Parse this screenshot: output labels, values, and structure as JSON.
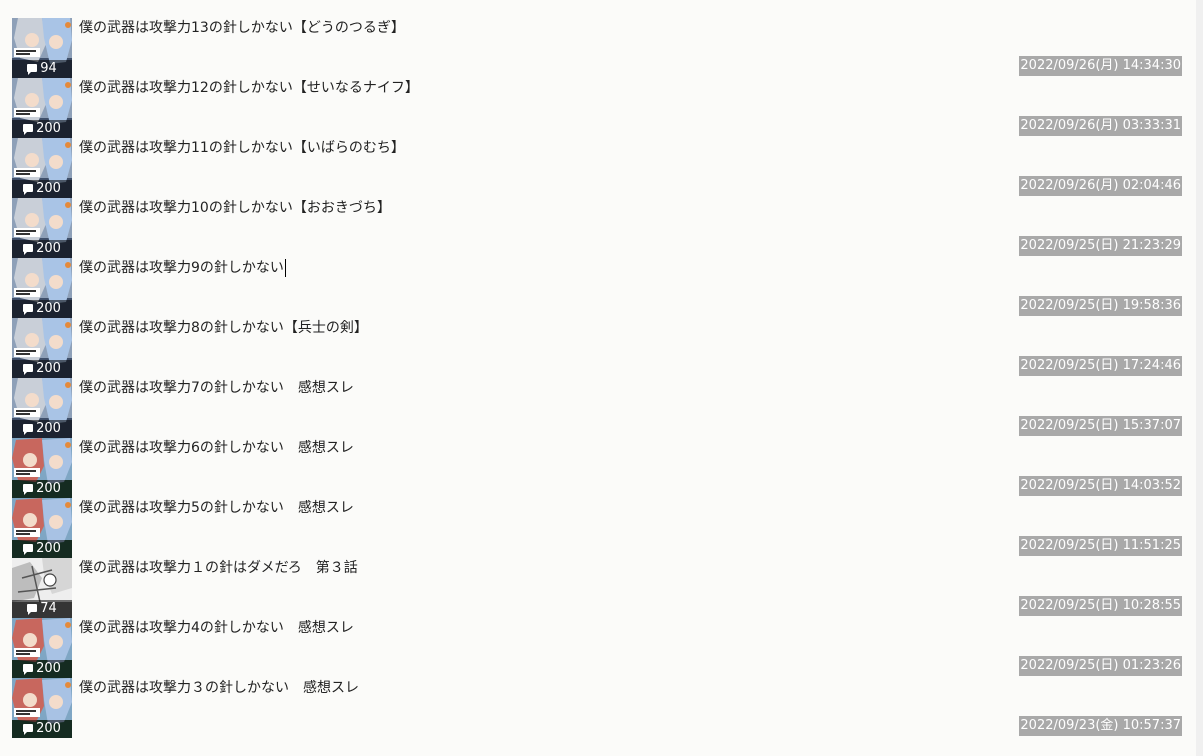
{
  "threads": [
    {
      "title": "僕の武器は攻撃力13の針しかない【どうのつるぎ】",
      "count": "94",
      "date": "2022/09/26(月) 14:34:30",
      "thumb": "bluegirl"
    },
    {
      "title": "僕の武器は攻撃力12の針しかない【せいなるナイフ】",
      "count": "200",
      "date": "2022/09/26(月) 03:33:31",
      "thumb": "bluegirl"
    },
    {
      "title": "僕の武器は攻撃力11の針しかない【いばらのむち】",
      "count": "200",
      "date": "2022/09/26(月) 02:04:46",
      "thumb": "bluegirl"
    },
    {
      "title": "僕の武器は攻撃力10の針しかない【おおきづち】",
      "count": "200",
      "date": "2022/09/25(日) 21:23:29",
      "thumb": "bluegirl"
    },
    {
      "title": "僕の武器は攻撃力9の針しかない",
      "count": "200",
      "date": "2022/09/25(日) 19:58:36",
      "thumb": "bluegirl",
      "caret": true
    },
    {
      "title": "僕の武器は攻撃力8の針しかない【兵士の剣】",
      "count": "200",
      "date": "2022/09/25(日) 17:24:46",
      "thumb": "bluegirl"
    },
    {
      "title": "僕の武器は攻撃力7の針しかない　感想スレ",
      "count": "200",
      "date": "2022/09/25(日) 15:37:07",
      "thumb": "bluegirl"
    },
    {
      "title": "僕の武器は攻撃力6の針しかない　感想スレ",
      "count": "200",
      "date": "2022/09/25(日) 14:03:52",
      "thumb": "redgirl"
    },
    {
      "title": "僕の武器は攻撃力5の針しかない　感想スレ",
      "count": "200",
      "date": "2022/09/25(日) 11:51:25",
      "thumb": "redgirl"
    },
    {
      "title": "僕の武器は攻撃力１の針はダメだろ　第３話",
      "count": "74",
      "date": "2022/09/25(日) 10:28:55",
      "thumb": "manga"
    },
    {
      "title": "僕の武器は攻撃力4の針しかない　感想スレ",
      "count": "200",
      "date": "2022/09/25(日) 01:23:26",
      "thumb": "redgirl"
    },
    {
      "title": "僕の武器は攻撃力３の針しかない　感想スレ",
      "count": "200",
      "date": "2022/09/23(金) 10:57:37",
      "thumb": "redgirl"
    }
  ]
}
